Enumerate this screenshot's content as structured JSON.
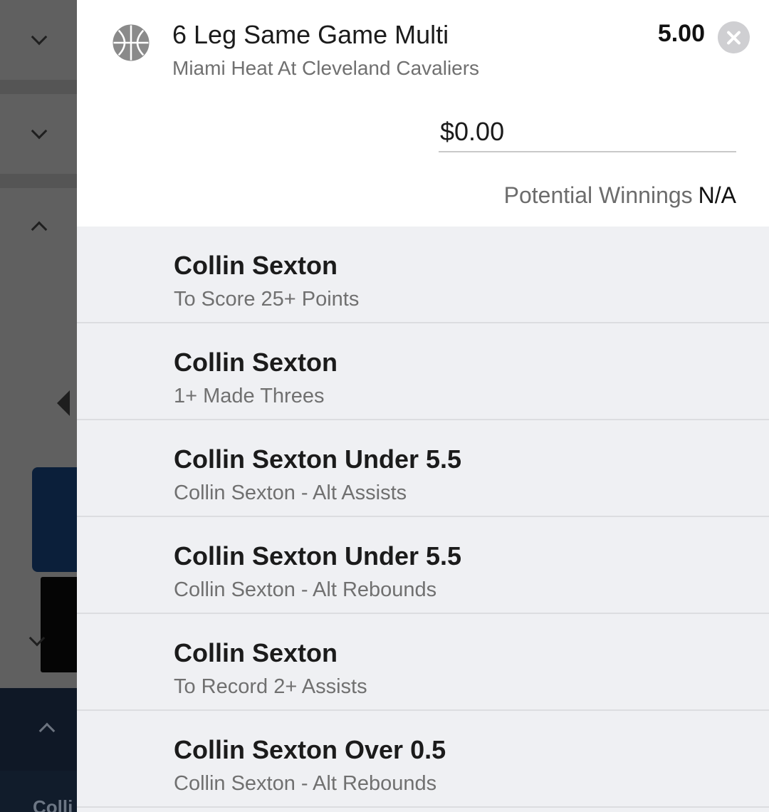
{
  "background": {
    "footer_text": "Colli"
  },
  "bet": {
    "sport_icon": "basketball-icon",
    "title": "6 Leg Same Game Multi",
    "event": "Miami Heat At Cleveland Cavaliers",
    "odds": "5.00",
    "stake_value": "$0.00",
    "potential_winnings_label": "Potential Winnings",
    "potential_winnings_value": "N/A"
  },
  "legs": [
    {
      "title": "Collin Sexton",
      "subtitle": "To Score 25+ Points"
    },
    {
      "title": "Collin Sexton",
      "subtitle": "1+ Made Threes"
    },
    {
      "title": "Collin Sexton Under 5.5",
      "subtitle": "Collin Sexton - Alt Assists"
    },
    {
      "title": "Collin Sexton Under 5.5",
      "subtitle": "Collin Sexton - Alt Rebounds"
    },
    {
      "title": "Collin Sexton",
      "subtitle": "To Record 2+ Assists"
    },
    {
      "title": "Collin Sexton Over 0.5",
      "subtitle": "Collin Sexton - Alt Rebounds"
    }
  ],
  "colors": {
    "panel_bg": "#eff0f3",
    "header_bg": "#ffffff",
    "overlay": "#606060",
    "close_button": "#cfcfd2"
  }
}
